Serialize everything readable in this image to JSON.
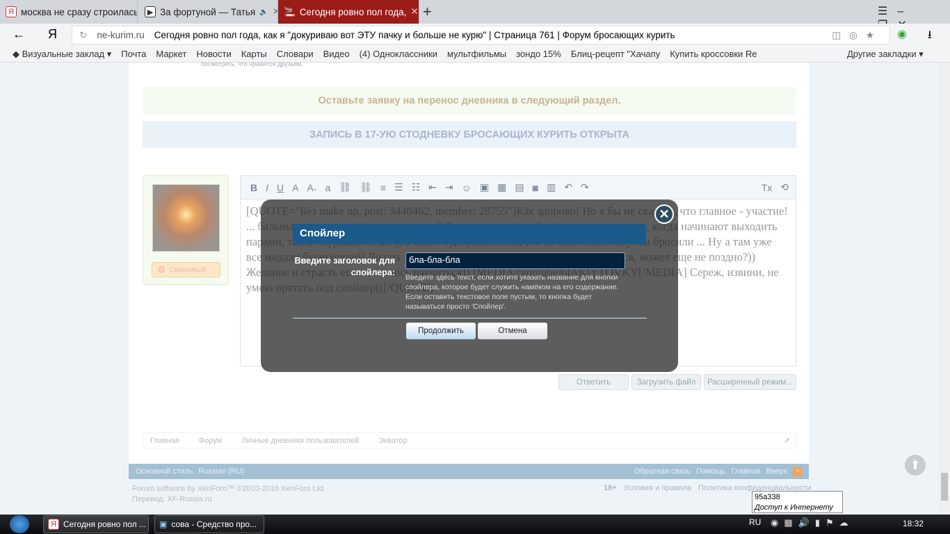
{
  "tabs": [
    {
      "label": "москва не сразу строилась"
    },
    {
      "label": "За фортуной — Татья"
    },
    {
      "label": "Сегодня ровно пол года,"
    }
  ],
  "address": {
    "domain": "ne-kurim.ru",
    "title": "Сегодня ровно пол года, как я \"докуриваю вот ЭТУ пачку и больше не курю\" | Страница 761 | Форум бросающих курить"
  },
  "bookmarks": [
    "Визуальные заклад",
    "Почта",
    "Маркет",
    "Новости",
    "Карты",
    "Словари",
    "Видео",
    "(4) Одноклассники",
    "мультфильмы",
    "зондо 15%",
    "Блиц-рецепт \"Хачапу",
    "Купить кроссовки Re",
    "Другие закладки"
  ],
  "top_fragment": "посмотреть, что нравится друзьям.",
  "notices": {
    "transfer": "Оставьте заявку на перенос дневника в следующий раздел.",
    "signup": "ЗАПИСЬ В 17-УЮ СТОДНЕВКУ БРОСАЮЩИХ КУРИТЬ ОТКРЫТА"
  },
  "user": {
    "mood": "Сварливый"
  },
  "editor": {
    "text": "[QUOTE=\"Без make up, post: 3440462, member: 28755\"]Как здорово! Но я бы не сказала, что главное - участие! ... бальные, до сих пор от воспоминаний \"мурашки по коже\"..когда звучит музыка, когда начинают выходить парами, так и \"мурашки ... ки\")) а танго с девушкой..нет, это не танго..Поэтому мы бросили ... Ну а там уже все медали были наши)) До сих пор когда смотрю как танцуют танго, думается, может еще не поздно?)) Желание и страсть есть..осталось научиться)) [MEDIA=youtube]6lAKlYTQVKY[/MEDIA] Сереж, извини, не умею прятать под спойлер(([/QUOTE]"
  },
  "post_buttons": {
    "reply": "Ответить",
    "upload": "Загрузить файл",
    "advanced": "Расширенный режим..."
  },
  "modal": {
    "title": "Спойлер",
    "label": "Введите заголовок для спойлера:",
    "value": "бла-бла-бла",
    "hint": "Введите здесь текст, если хотите указать название для кнопки спойлера, которое будет служить намёком на его содержание. Если оставить текстовое поле пустым, то кнопка будет называться просто 'Спойлер'.",
    "continue": "Продолжить",
    "cancel": "Отмена"
  },
  "breadcrumb": [
    "Главная",
    "Форум",
    "Личные дневники пользователей",
    "Экватор"
  ],
  "footer": {
    "style": "Основной стиль",
    "lang": "Russian (RU)",
    "links": [
      "Обратная связь",
      "Помощь",
      "Главная",
      "Вверх"
    ],
    "copyright": "Forum software by XenForo™ ©2010-2016 XenForo Ltd.",
    "translation": "Перевод: XF-Russia.ru",
    "age": "18+",
    "terms": "Условия и правила",
    "privacy": "Политика конфиденциальности"
  },
  "tooltip": {
    "network": "95a338",
    "status": "Доступ к Интернету"
  },
  "taskbar": {
    "items": [
      "Сегодня ровно пол ...",
      "сова - Средство про..."
    ],
    "lang": "RU",
    "time": "18:32"
  },
  "colors": {
    "active_tab": "#9c1c1a",
    "modal_title": "#1a5b8c",
    "footer_bar": "#a3bfd4"
  }
}
